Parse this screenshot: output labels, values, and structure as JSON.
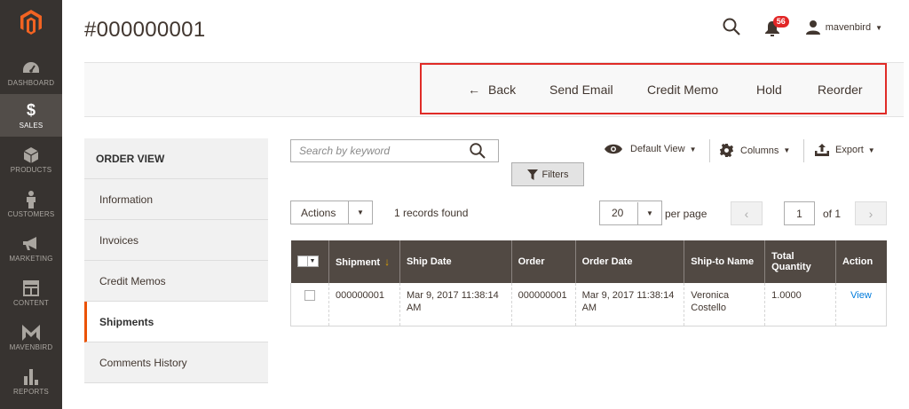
{
  "page": {
    "title": "#000000001"
  },
  "sidebar": {
    "logo_icon": "magento-logo-icon",
    "items": [
      {
        "label": "DASHBOARD",
        "icon": "speedometer-icon"
      },
      {
        "label": "SALES",
        "icon": "dollar-icon",
        "active": true
      },
      {
        "label": "PRODUCTS",
        "icon": "cube-icon"
      },
      {
        "label": "CUSTOMERS",
        "icon": "person-icon"
      },
      {
        "label": "MARKETING",
        "icon": "megaphone-icon"
      },
      {
        "label": "CONTENT",
        "icon": "layout-icon"
      },
      {
        "label": "MAVENBIRD",
        "icon": "mavenbird-logo-icon"
      },
      {
        "label": "REPORTS",
        "icon": "bar-chart-icon"
      }
    ]
  },
  "header": {
    "notifications_count": "56",
    "username": "mavenbird"
  },
  "action_bar": {
    "back": "Back",
    "send_email": "Send Email",
    "credit_memo": "Credit Memo",
    "hold": "Hold",
    "reorder": "Reorder"
  },
  "tabs": {
    "heading": "ORDER VIEW",
    "items": [
      "Information",
      "Invoices",
      "Credit Memos",
      "Shipments",
      "Comments History"
    ],
    "active": "Shipments"
  },
  "grid_controls": {
    "search_placeholder": "Search by keyword",
    "filters": "Filters",
    "default_view": "Default View",
    "columns": "Columns",
    "export": "Export",
    "actions": "Actions",
    "records_found": "1 records found",
    "per_page_value": "20",
    "per_page_label": "per page",
    "current_page": "1",
    "total_pages_label": "of 1"
  },
  "table": {
    "headers": [
      "Shipment",
      "Ship Date",
      "Order",
      "Order Date",
      "Ship-to Name",
      "Total Quantity",
      "Action"
    ],
    "rows": [
      {
        "shipment": "000000001",
        "ship_date": "Mar 9, 2017 11:38:14 AM",
        "order": "000000001",
        "order_date": "Mar 9, 2017 11:38:14 AM",
        "ship_to_name": "Veronica Costello",
        "total_quantity": "1.0000",
        "action": "View"
      }
    ]
  },
  "colors": {
    "sidebar_bg": "#373330",
    "accent_orange": "#eb5202",
    "highlight_red": "#e02b27",
    "table_header": "#514943",
    "link_blue": "#007bdb"
  }
}
